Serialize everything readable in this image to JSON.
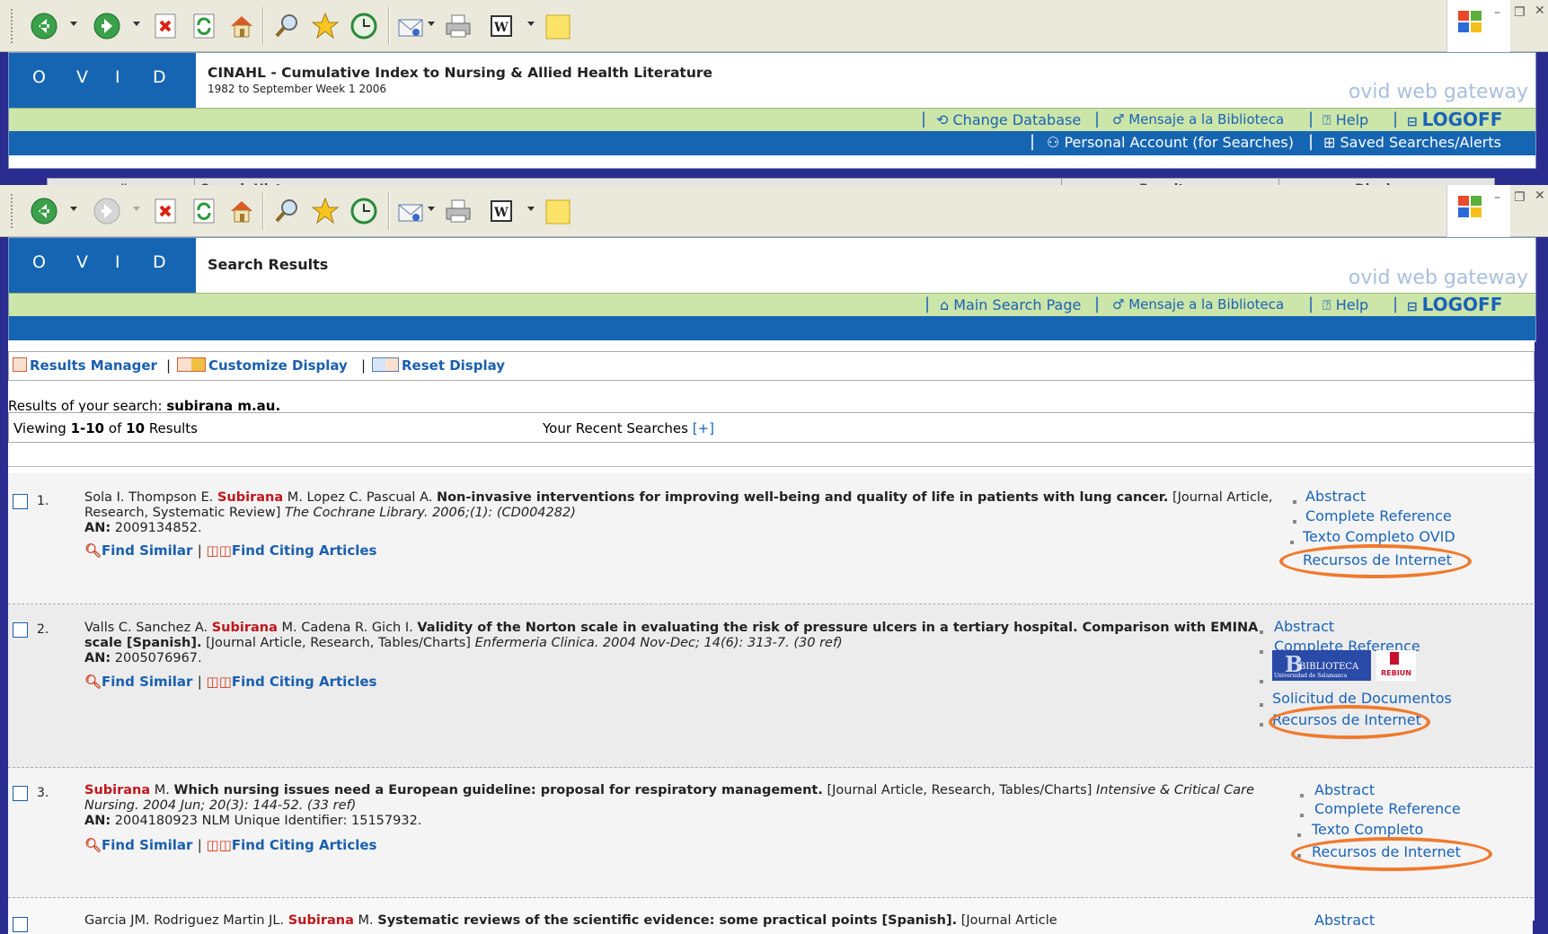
{
  "browser": {
    "toolbar_icons": [
      "back-icon",
      "forward-icon",
      "stop-icon",
      "refresh-icon",
      "home-icon",
      "search-icon",
      "favorites-icon",
      "history-icon",
      "mail-icon",
      "print-icon",
      "word-icon",
      "note-icon"
    ]
  },
  "window1": {
    "logo_letters": [
      "O",
      "V",
      "I",
      "D"
    ],
    "db_title": "CINAHL - Cumulative Index to Nursing & Allied Health Literature",
    "db_subtitle": "1982 to September Week 1 2006",
    "gateway": "ovid web gateway",
    "nav": {
      "change_database": "Change Database",
      "mensaje": "Mensaje a la Biblioteca",
      "help": "Help",
      "logoff": "LOGOFF"
    },
    "subnav": {
      "personal_account": "Personal Account (for Searches)",
      "saved_searches": "Saved Searches/Alerts"
    },
    "history_headers": [
      "#",
      "Search History",
      "Results",
      "Display"
    ]
  },
  "window2": {
    "logo_letters": [
      "O",
      "V",
      "I",
      "D"
    ],
    "page_title": "Search Results",
    "gateway": "ovid web gateway",
    "nav": {
      "main_search": "Main Search Page",
      "mensaje": "Mensaje a la Biblioteca",
      "help": "Help",
      "logoff": "LOGOFF"
    }
  },
  "results": {
    "tools": {
      "results_manager": "Results Manager",
      "customize_display": "Customize Display",
      "reset_display": "Reset Display"
    },
    "results_of_label": "Results of your search:",
    "query": "subirana m.au.",
    "viewing_label": "Viewing",
    "viewing_range": "1-10",
    "of_label": "of",
    "total": "10",
    "results_word": "Results",
    "recent_searches": "Your Recent Searches",
    "recent_toggle": "[+]",
    "find_similar": "Find Similar",
    "find_citing": "Find Citing Articles",
    "records": [
      {
        "num": "1.",
        "authors_before": "Sola I. Thompson E.",
        "highlight": "Subirana",
        "authors_after": "M. Lopez C. Pascual A.",
        "title": "Non-invasive interventions for improving well-being and quality of life in patients with lung cancer.",
        "pubtype": "[Journal Article, Research, Systematic Review]",
        "source": "The Cochrane Library. 2006;(1): (CD004282)",
        "an_label": "AN:",
        "an": "2009134852.",
        "links": [
          "Abstract",
          "Complete Reference",
          "Texto Completo OVID",
          "Recursos de Internet"
        ]
      },
      {
        "num": "2.",
        "authors_before": "Valls C. Sanchez A.",
        "highlight": "Subirana",
        "authors_after": "M. Cadena R. Gich I.",
        "title": "Validity of the Norton scale in evaluating the risk of pressure ulcers in a tertiary hospital. Comparison with EMINA scale [Spanish].",
        "pubtype": "[Journal Article, Research, Tables/Charts]",
        "source": "Enfermeria Clinica. 2004 Nov-Dec; 14(6): 313-7. (30 ref)",
        "an_label": "AN:",
        "an": "2005076967.",
        "links": [
          "Abstract",
          "Complete Reference",
          "Solicitud de Documentos",
          "Recursos de Internet"
        ],
        "biblioteca_logo": "BIBLIOTECA",
        "biblioteca_sub": "Universidad de Salamanca",
        "rebiun": "REBIUN"
      },
      {
        "num": "3.",
        "authors_before": "",
        "highlight": "Subirana",
        "authors_after": "M.",
        "title": "Which nursing issues need a European guideline: proposal for respiratory management.",
        "pubtype": "[Journal Article, Research, Tables/Charts]",
        "source": "Intensive & Critical Care Nursing. 2004 Jun; 20(3): 144-52. (33 ref)",
        "an_label": "AN:",
        "an": "2004180923 NLM Unique Identifier: 15157932.",
        "links": [
          "Abstract",
          "Complete Reference",
          "Texto Completo",
          "Recursos de Internet"
        ]
      },
      {
        "authors_before": "Garcia JM. Rodriguez Martin JL.",
        "highlight": "Subirana",
        "authors_after": "M.",
        "title": "Systematic reviews of the scientific evidence: some practical points [Spanish].",
        "pubtype": "[Journal Article",
        "links": [
          "Abstract"
        ]
      }
    ]
  },
  "colors": {
    "ovid_blue": "#1565b3",
    "nav_green": "#cce5a8",
    "link_blue": "#1a63b8",
    "highlight_red": "#c0171c",
    "annotation_orange": "#f07a2d"
  }
}
